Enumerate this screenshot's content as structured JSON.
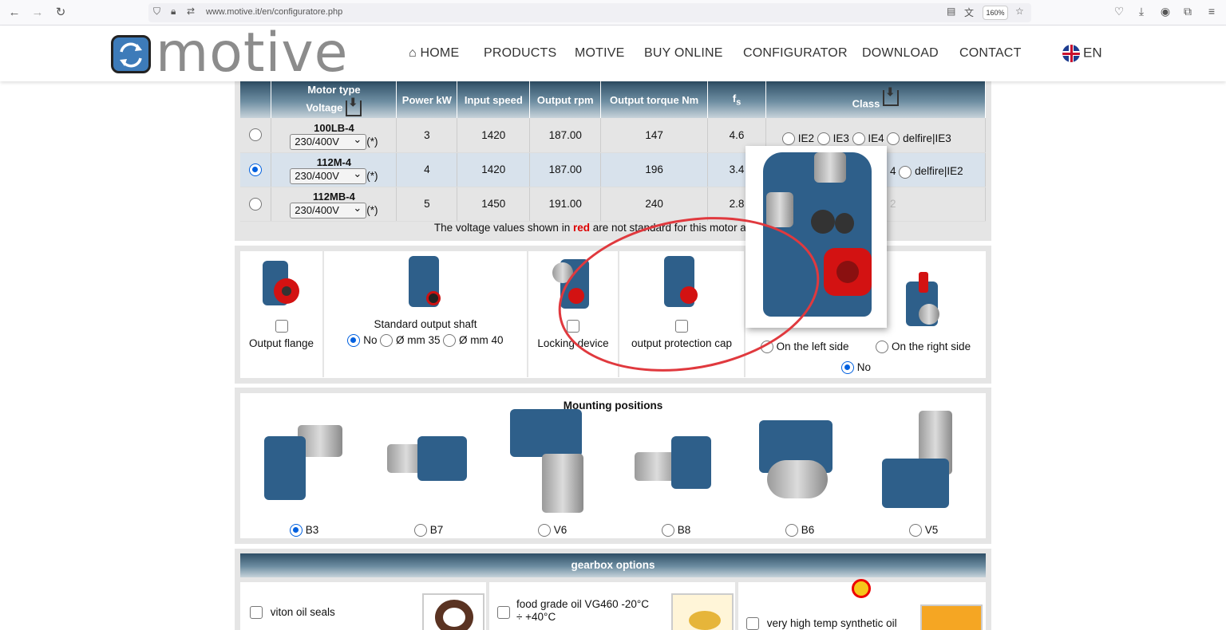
{
  "browser": {
    "url": "www.motive.it/en/configuratore.php",
    "zoom": "160%"
  },
  "header": {
    "logo_text": "motive",
    "menu": [
      {
        "label": "HOME"
      },
      {
        "label": "PRODUCTS"
      },
      {
        "label": "MOTIVE"
      },
      {
        "label": "BUY ONLINE"
      },
      {
        "label": "CONFIGURATOR"
      },
      {
        "label": "DOWNLOAD"
      },
      {
        "label": "CONTACT"
      }
    ],
    "language": "EN"
  },
  "motor_table": {
    "headers": {
      "motor_type": "Motor type",
      "voltage": "Voltage",
      "power": "Power kW",
      "input_speed": "Input speed",
      "output_rpm": "Output rpm",
      "output_torque": "Output torque Nm",
      "fs": "f",
      "fs_sub": "s",
      "class": "Class"
    },
    "rows": [
      {
        "name": "100LB-4",
        "voltage": "230/400V",
        "asterisk": "(*)",
        "power": "3",
        "input": "1420",
        "rpm": "187.00",
        "torque": "147",
        "fs": "4.6",
        "classes": [
          "IE2",
          "IE3",
          "IE4",
          "delfire|IE3"
        ]
      },
      {
        "name": "112M-4",
        "voltage": "230/400V",
        "asterisk": "(*)",
        "power": "4",
        "input": "1420",
        "rpm": "187.00",
        "torque": "196",
        "fs": "3.4",
        "classes_tail": "4",
        "class_last": "delfire|IE2"
      },
      {
        "name": "112MB-4",
        "voltage": "230/400V",
        "asterisk": "(*)",
        "power": "5",
        "input": "1450",
        "rpm": "191.00",
        "torque": "240",
        "fs": "2.8",
        "classes_tail": "2"
      }
    ],
    "note_before": "The voltage values shown in ",
    "note_red": "red",
    "note_after": " are not standard for this motor and should be"
  },
  "options": {
    "output_flange": "Output flange",
    "standard_shaft": "Standard output shaft",
    "shaft_no": "No",
    "shaft_35": "Ø mm 35",
    "shaft_40": "Ø mm 40",
    "locking_device": "Locking device",
    "protection_cap": "output protection cap",
    "left_side": "On the left side",
    "right_side": "On the right side",
    "side_no": "No"
  },
  "mounting": {
    "title": "Mounting positions",
    "positions": [
      "B3",
      "B7",
      "V6",
      "B8",
      "B6",
      "V5"
    ],
    "selected": "B3"
  },
  "gearbox_options": {
    "title": "gearbox options",
    "items": [
      {
        "label": "viton oil seals"
      },
      {
        "label": "food grade oil VG460 -20°C",
        "label2": "÷ +40°C"
      },
      {
        "label": "very high temp synthetic oil"
      }
    ]
  }
}
